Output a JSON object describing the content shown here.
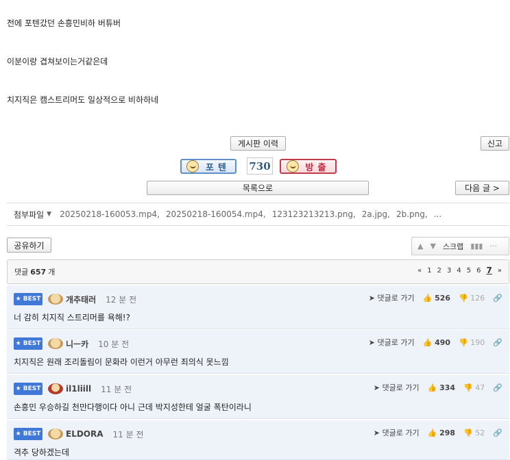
{
  "post": {
    "lines": [
      "전에 포텐갔던 손흥민비하 버튜버",
      "이분이랑 겹쳐보이는거같은데",
      "치지직은 캠스트리머도 일상적으로 비하하네"
    ]
  },
  "buttons": {
    "history": "게시판 이력",
    "report": "신고",
    "list": "목록으로",
    "next": "다음 글 >",
    "share": "공유하기"
  },
  "vote": {
    "up_label": "포텐",
    "down_label": "방출",
    "count": "730"
  },
  "attachments": {
    "label": "첨부파일",
    "caret": "▼",
    "files": [
      "20250218-160053.mp4,",
      "20250218-160054.mp4,",
      "123123213213.png,",
      "2a.jpg,",
      "2b.png,",
      "..."
    ]
  },
  "toolbar": {
    "up": "▲",
    "down": "▼",
    "scrap": "스크랩",
    "stats": "▮▮▮",
    "more": "···"
  },
  "comments_header": {
    "label": "댓글",
    "count": "657",
    "unit": "개",
    "pages": [
      "«",
      "1",
      "2",
      "3",
      "4",
      "5",
      "6",
      "7",
      "»"
    ],
    "current_page": "7"
  },
  "comments": [
    {
      "badge": "★ BEST",
      "nick": "개추태러",
      "time": "12 분 전",
      "text": "너 감히 치지직 스트리머를 욕해!?",
      "reply": "➤ 댓글로 가기",
      "up": "👍 526",
      "down": "👎 126",
      "link": "🔗"
    },
    {
      "badge": "★ BEST",
      "nick": "니ㅡ카",
      "time": "10 분 전",
      "text": "치지직은 원래 조리돌림이 문화라 이런거 아무런 죄의식 못느낌",
      "reply": "➤ 댓글로 가기",
      "up": "👍 490",
      "down": "👎 190",
      "link": "🔗"
    },
    {
      "badge": "★ BEST",
      "nick": "il1liill",
      "time": "11 분 전",
      "text": "손흥민 우승하길 천만다행이다 아니 근데 박지성한테 얼굴 폭탄이라니",
      "reply": "➤ 댓글로 가기",
      "up": "👍 334",
      "down": "👎 47",
      "link": "🔗"
    },
    {
      "badge": "★ BEST",
      "nick": "ELDORA",
      "time": "11 분 전",
      "text": "격추 당하겠는데",
      "reply": "➤ 댓글로 가기",
      "up": "👍 298",
      "down": "👎 52",
      "link": "🔗"
    }
  ]
}
